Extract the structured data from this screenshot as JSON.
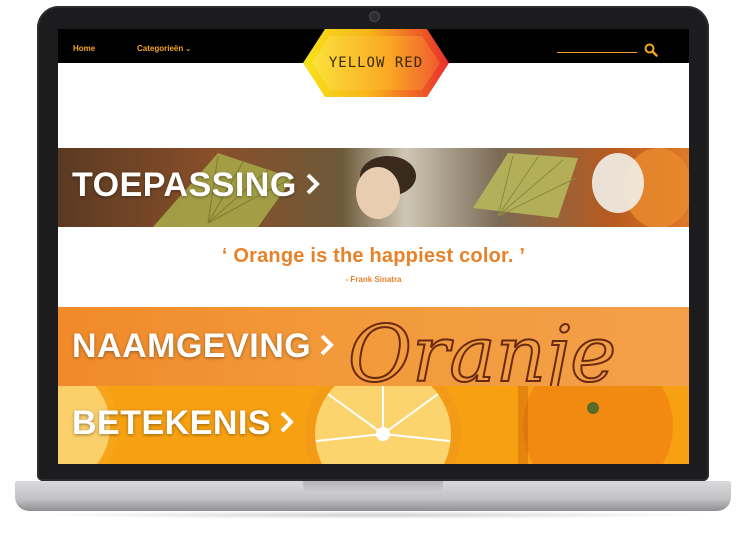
{
  "navbar": {
    "home_label": "Home",
    "categories_label": "Categorieën",
    "logo_text": "YELLOW RED"
  },
  "banners": [
    {
      "label": "TOEPASSING"
    },
    {
      "label": "NAAMGEVING"
    },
    {
      "label": "BETEKENIS"
    }
  ],
  "quote": {
    "text": "‘ Orange is the happiest color. ’",
    "author": "- Frank Sinatra"
  },
  "decor": {
    "naamgeving_script": "Oranje"
  },
  "colors": {
    "accent": "#f5a623",
    "quote": "#e8822a",
    "navbar": "#000000"
  },
  "icons": {
    "search": "search-icon",
    "chevron": "chevron-right-icon"
  }
}
